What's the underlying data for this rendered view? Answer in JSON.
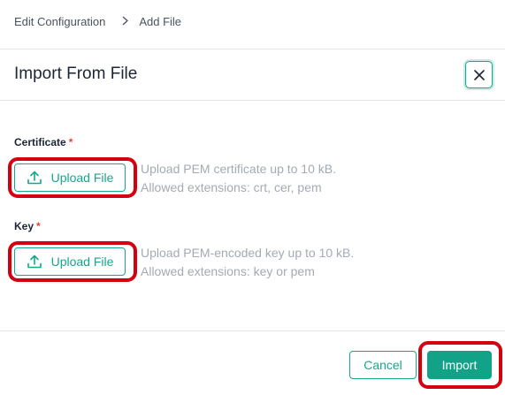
{
  "breadcrumb": {
    "parent": "Edit Configuration",
    "separator_icon": "chevron-right-icon",
    "current": "Add File"
  },
  "dialog": {
    "title": "Import From File",
    "close_icon": "close-icon"
  },
  "fields": {
    "certificate": {
      "label": "Certificate",
      "required_marker": "*",
      "button_label": "Upload File",
      "button_icon": "upload-icon",
      "hint_line1": "Upload PEM certificate up to 10 kB.",
      "hint_line2": "Allowed extensions: crt, cer, pem"
    },
    "key": {
      "label": "Key",
      "required_marker": "*",
      "button_label": "Upload File",
      "button_icon": "upload-icon",
      "hint_line1": "Upload PEM-encoded key up to 10 kB.",
      "hint_line2": "Allowed extensions: key or pem"
    }
  },
  "footer": {
    "cancel_label": "Cancel",
    "import_label": "Import"
  },
  "colors": {
    "accent": "#17a78b",
    "primary_button": "#12a287",
    "required": "#e0453a",
    "highlight": "#d4000f"
  }
}
